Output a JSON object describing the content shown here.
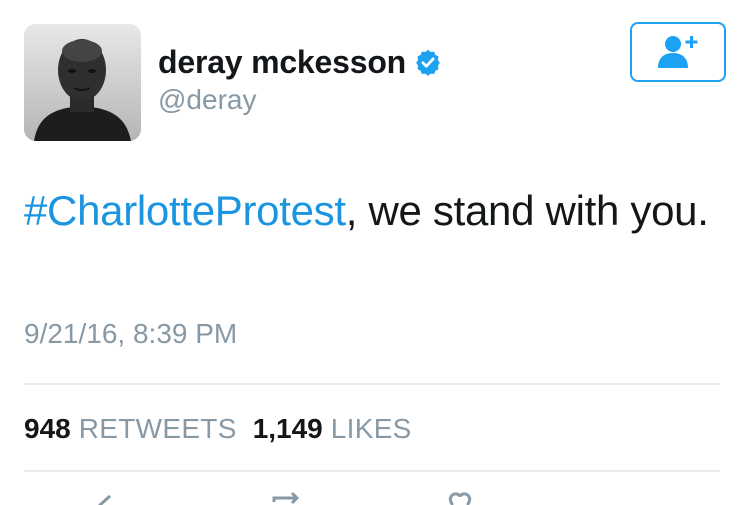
{
  "user": {
    "display_name": "deray mckesson",
    "handle": "@deray",
    "verified": true
  },
  "tweet": {
    "hashtag": "#CharlotteProtest",
    "text_rest": ", we stand with you.",
    "timestamp": "9/21/16, 8:39 PM"
  },
  "stats": {
    "retweets_count": "948",
    "retweets_label": "RETWEETS",
    "likes_count": "1,149",
    "likes_label": "LIKES"
  },
  "icons": {
    "follow": "add-user-icon",
    "verified": "verified-badge-icon",
    "reply": "reply-icon",
    "retweet": "retweet-icon",
    "like": "heart-icon"
  },
  "colors": {
    "accent": "#1da1f2",
    "link": "#1b95e0",
    "muted": "#8899a6",
    "text": "#14171a"
  }
}
